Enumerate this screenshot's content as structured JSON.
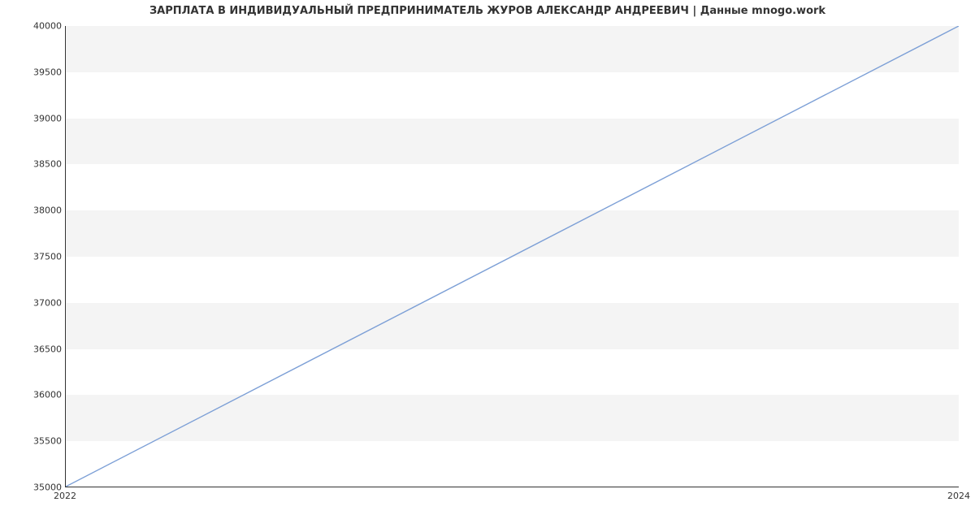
{
  "chart_data": {
    "type": "line",
    "title": "ЗАРПЛАТА В ИНДИВИДУАЛЬНЫЙ ПРЕДПРИНИМАТЕЛЬ ЖУРОВ АЛЕКСАНДР АНДРЕЕВИЧ | Данные mnogo.work",
    "x": [
      2022,
      2024
    ],
    "values": [
      35000,
      40000
    ],
    "xlabel": "",
    "ylabel": "",
    "ylim": [
      35000,
      40000
    ],
    "y_ticks": [
      35000,
      35500,
      36000,
      36500,
      37000,
      37500,
      38000,
      38500,
      39000,
      39500,
      40000
    ],
    "x_ticks": [
      2022,
      2024
    ],
    "line_color": "#7c9fd6",
    "band_color": "#f4f4f4"
  }
}
